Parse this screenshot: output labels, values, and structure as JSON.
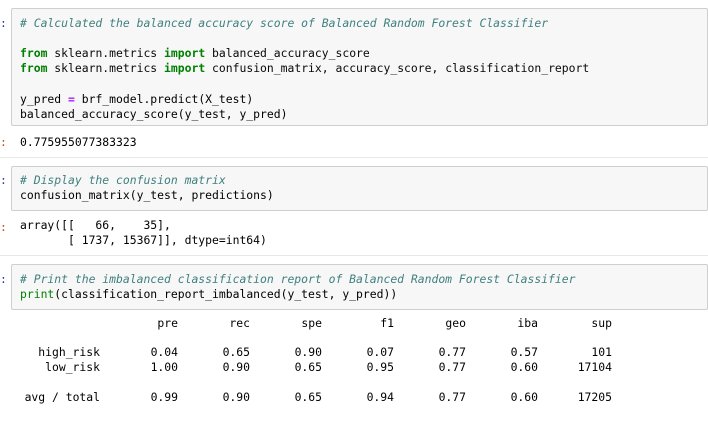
{
  "cells": {
    "c1": {
      "input_prompt": ":",
      "comment": "# Calculated the balanced accuracy score of Balanced Random Forest Classifier",
      "import1_from": "from",
      "import1_module": " sklearn.metrics ",
      "import1_import": "import",
      "import1_names": " balanced_accuracy_score",
      "import2_from": "from",
      "import2_module": " sklearn.metrics ",
      "import2_import": "import",
      "import2_names": " confusion_matrix, accuracy_score, classification_report",
      "line4_a": "y_pred ",
      "line4_eq": "=",
      "line4_b": " brf_model.predict(X_test)",
      "line5": "balanced_accuracy_score(y_test, y_pred)",
      "output_prompt": ":",
      "output": "0.775955077383323"
    },
    "c2": {
      "input_prompt": ":",
      "comment": "# Display the confusion matrix",
      "line2": "confusion_matrix(y_test, predictions)",
      "output_prompt": ":",
      "output_line1": "array([[   66,    35],",
      "output_line2": "       [ 1737, 15367]], dtype=int64)"
    },
    "c3": {
      "input_prompt": ":",
      "comment": "# Print the imbalanced classification report of Balanced Random Forest Classifier",
      "line2_fn": "print",
      "line2_rest": "(classification_report_imbalanced(y_test, y_pred))"
    }
  },
  "report": {
    "headers": [
      "pre",
      "rec",
      "spe",
      "f1",
      "geo",
      "iba",
      "sup"
    ],
    "rows": [
      {
        "label": "high_risk",
        "values": [
          "0.04",
          "0.65",
          "0.90",
          "0.07",
          "0.77",
          "0.57",
          "101"
        ]
      },
      {
        "label": "low_risk",
        "values": [
          "1.00",
          "0.90",
          "0.65",
          "0.95",
          "0.77",
          "0.60",
          "17104"
        ]
      }
    ],
    "total": {
      "label": "avg / total",
      "values": [
        "0.99",
        "0.90",
        "0.65",
        "0.94",
        "0.77",
        "0.60",
        "17205"
      ]
    }
  }
}
